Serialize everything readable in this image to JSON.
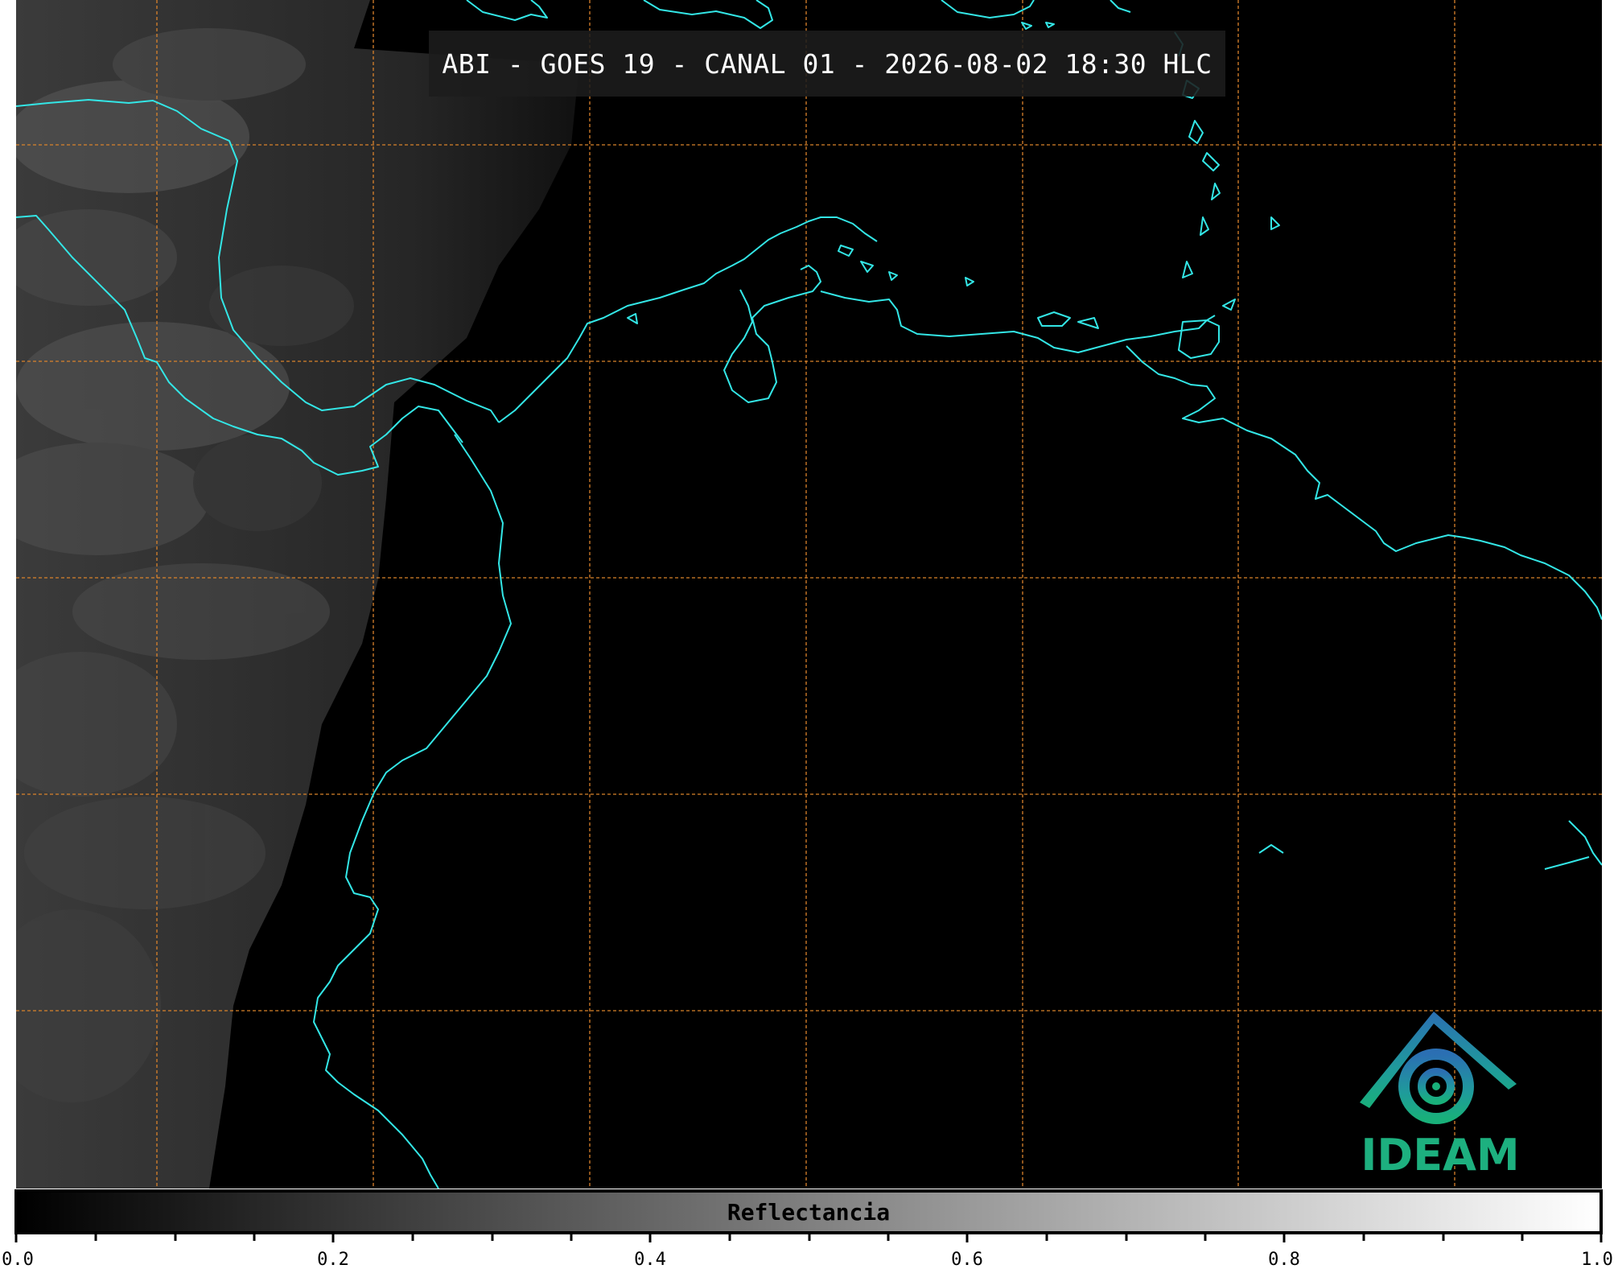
{
  "map": {
    "title": "ABI - GOES 19 - CANAL 01 - 2026-08-02 18:30 HLC",
    "colors": {
      "coastline": "#33e6e6",
      "gridline": "#d9822b",
      "background": "#000000"
    }
  },
  "logo": {
    "text": "IDEAM",
    "icon": "ideam-logo-icon"
  },
  "colorbar": {
    "label": "Reflectancia",
    "ticks": [
      "0.0",
      "0.2",
      "0.4",
      "0.6",
      "0.8",
      "1.0"
    ],
    "range": [
      0.0,
      1.0
    ],
    "colormap": "grayscale"
  }
}
